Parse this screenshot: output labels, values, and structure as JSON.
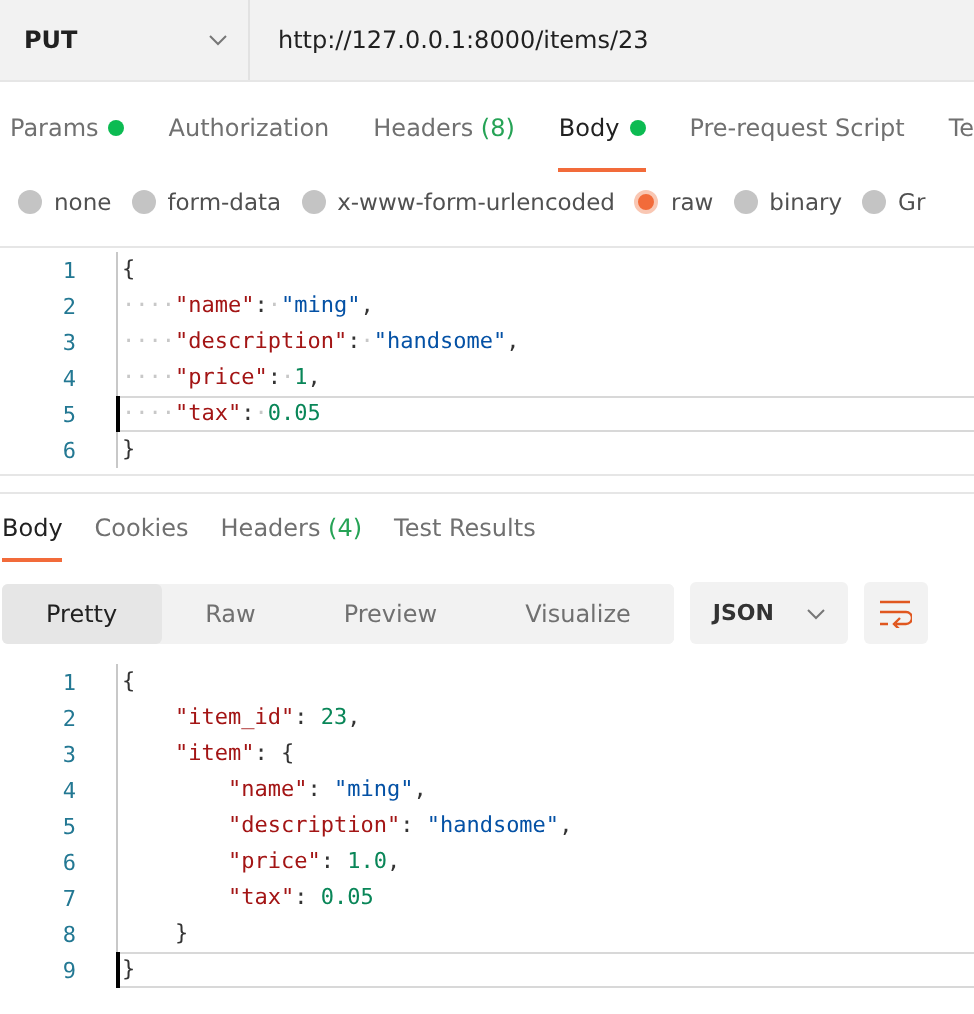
{
  "request": {
    "method": "PUT",
    "url": "http://127.0.0.1:8000/items/23"
  },
  "request_tabs": [
    {
      "label": "Params",
      "dot": true,
      "selected": false
    },
    {
      "label": "Authorization",
      "dot": false,
      "selected": false
    },
    {
      "label": "Headers",
      "count": "(8)",
      "dot": false,
      "selected": false
    },
    {
      "label": "Body",
      "dot": true,
      "selected": true
    },
    {
      "label": "Pre-request Script",
      "dot": false,
      "selected": false
    },
    {
      "label": "Te",
      "dot": false,
      "selected": false
    }
  ],
  "body_types": [
    {
      "label": "none",
      "selected": false
    },
    {
      "label": "form-data",
      "selected": false
    },
    {
      "label": "x-www-form-urlencoded",
      "selected": false
    },
    {
      "label": "raw",
      "selected": true
    },
    {
      "label": "binary",
      "selected": false
    },
    {
      "label": "Gr",
      "selected": false
    }
  ],
  "request_body": [
    {
      "number": "1",
      "current": false,
      "tokens": [
        {
          "kind": "punct",
          "text": "{"
        }
      ]
    },
    {
      "number": "2",
      "current": false,
      "tokens": [
        {
          "kind": "ws",
          "text": "····"
        },
        {
          "kind": "key",
          "text": "\"name\""
        },
        {
          "kind": "punct",
          "text": ":"
        },
        {
          "kind": "ws",
          "text": "·"
        },
        {
          "kind": "string",
          "text": "\"ming\""
        },
        {
          "kind": "punct",
          "text": ","
        }
      ]
    },
    {
      "number": "3",
      "current": false,
      "tokens": [
        {
          "kind": "ws",
          "text": "····"
        },
        {
          "kind": "key",
          "text": "\"description\""
        },
        {
          "kind": "punct",
          "text": ":"
        },
        {
          "kind": "ws",
          "text": "·"
        },
        {
          "kind": "string",
          "text": "\"handsome\""
        },
        {
          "kind": "punct",
          "text": ","
        }
      ]
    },
    {
      "number": "4",
      "current": false,
      "tokens": [
        {
          "kind": "ws",
          "text": "····"
        },
        {
          "kind": "key",
          "text": "\"price\""
        },
        {
          "kind": "punct",
          "text": ":"
        },
        {
          "kind": "ws",
          "text": "·"
        },
        {
          "kind": "number",
          "text": "1"
        },
        {
          "kind": "punct",
          "text": ","
        }
      ]
    },
    {
      "number": "5",
      "current": true,
      "tokens": [
        {
          "kind": "ws",
          "text": "····"
        },
        {
          "kind": "key",
          "text": "\"tax\""
        },
        {
          "kind": "punct",
          "text": ":"
        },
        {
          "kind": "ws",
          "text": "·"
        },
        {
          "kind": "number",
          "text": "0.05"
        }
      ]
    },
    {
      "number": "6",
      "current": false,
      "tokens": [
        {
          "kind": "punct",
          "text": "}"
        }
      ]
    }
  ],
  "response_tabs": [
    {
      "label": "Body",
      "selected": true
    },
    {
      "label": "Cookies",
      "selected": false
    },
    {
      "label": "Headers",
      "count": "(4)",
      "selected": false
    },
    {
      "label": "Test Results",
      "selected": false
    }
  ],
  "view_modes": [
    {
      "label": "Pretty",
      "selected": true
    },
    {
      "label": "Raw",
      "selected": false
    },
    {
      "label": "Preview",
      "selected": false
    },
    {
      "label": "Visualize",
      "selected": false
    }
  ],
  "format": "JSON",
  "response_body": [
    {
      "number": "1",
      "current": false,
      "tokens": [
        {
          "kind": "punct",
          "text": "{"
        }
      ]
    },
    {
      "number": "2",
      "current": false,
      "tokens": [
        {
          "kind": "key",
          "text": "    \"item_id\""
        },
        {
          "kind": "punct",
          "text": ": "
        },
        {
          "kind": "number",
          "text": "23"
        },
        {
          "kind": "punct",
          "text": ","
        }
      ]
    },
    {
      "number": "3",
      "current": false,
      "tokens": [
        {
          "kind": "key",
          "text": "    \"item\""
        },
        {
          "kind": "punct",
          "text": ": {"
        }
      ]
    },
    {
      "number": "4",
      "current": false,
      "tokens": [
        {
          "kind": "key",
          "text": "        \"name\""
        },
        {
          "kind": "punct",
          "text": ": "
        },
        {
          "kind": "string",
          "text": "\"ming\""
        },
        {
          "kind": "punct",
          "text": ","
        }
      ]
    },
    {
      "number": "5",
      "current": false,
      "tokens": [
        {
          "kind": "key",
          "text": "        \"description\""
        },
        {
          "kind": "punct",
          "text": ": "
        },
        {
          "kind": "string",
          "text": "\"handsome\""
        },
        {
          "kind": "punct",
          "text": ","
        }
      ]
    },
    {
      "number": "6",
      "current": false,
      "tokens": [
        {
          "kind": "key",
          "text": "        \"price\""
        },
        {
          "kind": "punct",
          "text": ": "
        },
        {
          "kind": "number",
          "text": "1.0"
        },
        {
          "kind": "punct",
          "text": ","
        }
      ]
    },
    {
      "number": "7",
      "current": false,
      "tokens": [
        {
          "kind": "key",
          "text": "        \"tax\""
        },
        {
          "kind": "punct",
          "text": ": "
        },
        {
          "kind": "number",
          "text": "0.05"
        }
      ]
    },
    {
      "number": "8",
      "current": false,
      "tokens": [
        {
          "kind": "punct",
          "text": "    }"
        }
      ]
    },
    {
      "number": "9",
      "current": true,
      "tokens": [
        {
          "kind": "punct",
          "text": "}"
        }
      ]
    }
  ]
}
